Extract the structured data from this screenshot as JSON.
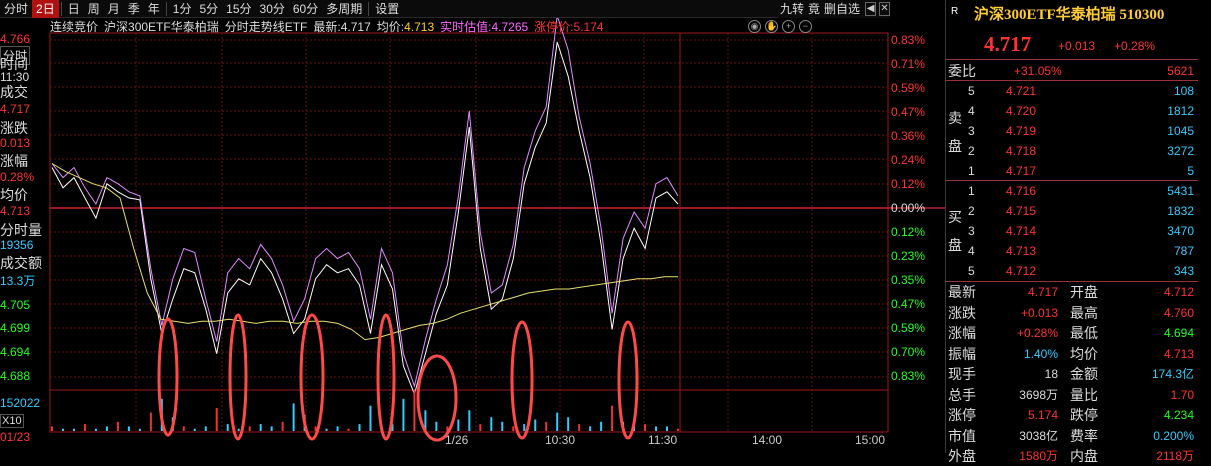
{
  "toolbar": {
    "tabs": [
      "分时",
      "2日",
      "日",
      "周",
      "月",
      "季",
      "年",
      "1分",
      "5分",
      "15分",
      "30分",
      "60分",
      "多周期",
      "设置"
    ],
    "active": 1,
    "right": [
      "九转",
      "竟",
      "删自选"
    ],
    "left_arrow": "◀",
    "close": "✕"
  },
  "infobar": {
    "mode": "连续竞价",
    "name": "沪深300ETF华泰柏瑞",
    "chart": "分时走势线ETF",
    "latest_label": "最新:",
    "latest": "4.717",
    "avg_label": "均价:",
    "avg": "4.713",
    "est_label": "实时估值:",
    "est": "4.7265",
    "limit_label": "涨停价:",
    "limit": "5.174"
  },
  "left": {
    "price_top": "4.766",
    "btn1": "分时",
    "l_time": "时间",
    "v_time": "11:30",
    "l_vol": "成交",
    "v_vol": "4.717",
    "l_chg": "涨跌",
    "v_chg": "0.013",
    "l_pct": "涨幅",
    "v_pct": "0.28%",
    "l_avg": "均价",
    "v_avg": "4.713",
    "l_lot": "分时量",
    "v_lot": "19356",
    "l_amt": "成交额",
    "v_amt": "13.3万",
    "p1": "4.705",
    "p2": "4.699",
    "p3": "4.694",
    "p4": "4.688",
    "vol": "152022",
    "x10": "X10",
    "date": "01/23"
  },
  "chart_data": {
    "type": "line",
    "title": "沪深300ETF华泰柏瑞 分时走势线ETF",
    "price_ticks_left": [
      "4.766",
      "4.705",
      "4.699",
      "4.694",
      "4.688"
    ],
    "pct_ticks_right_up": [
      "0.83%",
      "0.71%",
      "0.59%",
      "0.47%",
      "0.36%",
      "0.24%",
      "0.12%",
      "0.00%"
    ],
    "pct_ticks_right_down": [
      "0.12%",
      "0.23%",
      "0.35%",
      "0.47%",
      "0.59%",
      "0.70%",
      "0.83%"
    ],
    "x_labels": [
      "1/26",
      "10:30",
      "11:30",
      "14:00",
      "15:00"
    ],
    "prev_close_pct": 0,
    "series": [
      {
        "color": "#ffffff",
        "values": [
          0.2,
          0.1,
          0.15,
          0.05,
          -0.05,
          0.12,
          0.08,
          0.05,
          0.04,
          -0.35,
          -0.62,
          -0.45,
          -0.3,
          -0.32,
          -0.5,
          -0.72,
          -0.42,
          -0.35,
          -0.38,
          -0.25,
          -0.32,
          -0.45,
          -0.62,
          -0.55,
          -0.35,
          -0.28,
          -0.32,
          -0.3,
          -0.38,
          -0.62,
          -0.28,
          -0.4,
          -0.78,
          -0.92,
          -0.72,
          -0.52,
          -0.38,
          -0.02,
          0.4,
          -0.2,
          -0.5,
          -0.45,
          -0.25,
          0.12,
          0.3,
          0.42,
          0.82,
          0.65,
          0.38,
          0.15,
          -0.18,
          -0.6,
          -0.25,
          -0.1,
          -0.2,
          0.05,
          0.08,
          0.02
        ]
      },
      {
        "color": "#e08cff",
        "values": [
          0.22,
          0.15,
          0.2,
          0.1,
          0.02,
          0.15,
          0.12,
          0.08,
          0.06,
          -0.3,
          -0.58,
          -0.35,
          -0.2,
          -0.22,
          -0.45,
          -0.66,
          -0.32,
          -0.25,
          -0.3,
          -0.18,
          -0.25,
          -0.38,
          -0.56,
          -0.45,
          -0.25,
          -0.2,
          -0.25,
          -0.22,
          -0.3,
          -0.55,
          -0.2,
          -0.32,
          -0.72,
          -0.88,
          -0.65,
          -0.45,
          -0.28,
          0.06,
          0.48,
          -0.12,
          -0.42,
          -0.38,
          -0.18,
          0.2,
          0.38,
          0.5,
          0.95,
          0.78,
          0.45,
          0.22,
          -0.1,
          -0.52,
          -0.15,
          -0.02,
          -0.1,
          0.12,
          0.15,
          0.06
        ]
      },
      {
        "color": "#e8e070",
        "values": [
          0.22,
          0.18,
          0.15,
          0.12,
          0.1,
          0.05,
          -0.2,
          -0.42,
          -0.55,
          -0.56,
          -0.57,
          -0.56,
          -0.56,
          -0.55,
          -0.56,
          -0.57,
          -0.56,
          -0.56,
          -0.57,
          -0.56,
          -0.56,
          -0.57,
          -0.6,
          -0.65,
          -0.64,
          -0.62,
          -0.6,
          -0.58,
          -0.57,
          -0.55,
          -0.52,
          -0.5,
          -0.48,
          -0.46,
          -0.44,
          -0.42,
          -0.41,
          -0.4,
          -0.4,
          -0.39,
          -0.38,
          -0.37,
          -0.36,
          -0.35,
          -0.35,
          -0.34,
          -0.34
        ]
      }
    ],
    "annotations": "red ovals marking volume spikes",
    "volume": [
      2,
      1,
      1,
      3,
      1,
      2,
      4,
      2,
      1,
      8,
      14,
      6,
      2,
      1,
      2,
      10,
      3,
      1,
      2,
      3,
      2,
      4,
      12,
      7,
      2,
      1,
      2,
      1,
      3,
      11,
      2,
      3,
      14,
      18,
      9,
      4,
      2,
      5,
      9,
      3,
      6,
      4,
      2,
      3,
      5,
      4,
      8,
      6,
      3,
      2,
      4,
      11,
      4,
      2,
      3,
      2,
      2,
      1
    ]
  },
  "right": {
    "r_icon": "R",
    "title": "沪深300ETF华泰柏瑞 510300",
    "price": "4.717",
    "chg": "+0.013",
    "pct": "+0.28%",
    "ratio_label": "委比",
    "ratio": "+31.05%",
    "ratio_n": "5621",
    "sell_label": "卖盘",
    "buy_label": "买盘",
    "sells": [
      [
        "5",
        "4.721",
        "108"
      ],
      [
        "4",
        "4.720",
        "1812"
      ],
      [
        "3",
        "4.719",
        "1045"
      ],
      [
        "2",
        "4.718",
        "3272"
      ],
      [
        "1",
        "4.717",
        "5"
      ]
    ],
    "buys": [
      [
        "1",
        "4.716",
        "5431"
      ],
      [
        "2",
        "4.715",
        "1832"
      ],
      [
        "3",
        "4.714",
        "3470"
      ],
      [
        "4",
        "4.713",
        "787"
      ],
      [
        "5",
        "4.712",
        "343"
      ]
    ],
    "stats": [
      [
        "最新",
        "4.717",
        "开盘",
        "4.712"
      ],
      [
        "涨跌",
        "+0.013",
        "最高",
        "4.760"
      ],
      [
        "涨幅",
        "+0.28%",
        "最低",
        "4.694"
      ],
      [
        "振幅",
        "1.40%",
        "均价",
        "4.713"
      ],
      [
        "现手",
        "18",
        "金额",
        "174.3亿"
      ],
      [
        "总手",
        "3698万",
        "量比",
        "1.70"
      ],
      [
        "涨停",
        "5.174",
        "跌停",
        "4.234"
      ],
      [
        "市值",
        "3038亿",
        "费率",
        "0.200%"
      ],
      [
        "外盘",
        "1580万",
        "内盘",
        "2118万"
      ]
    ]
  }
}
